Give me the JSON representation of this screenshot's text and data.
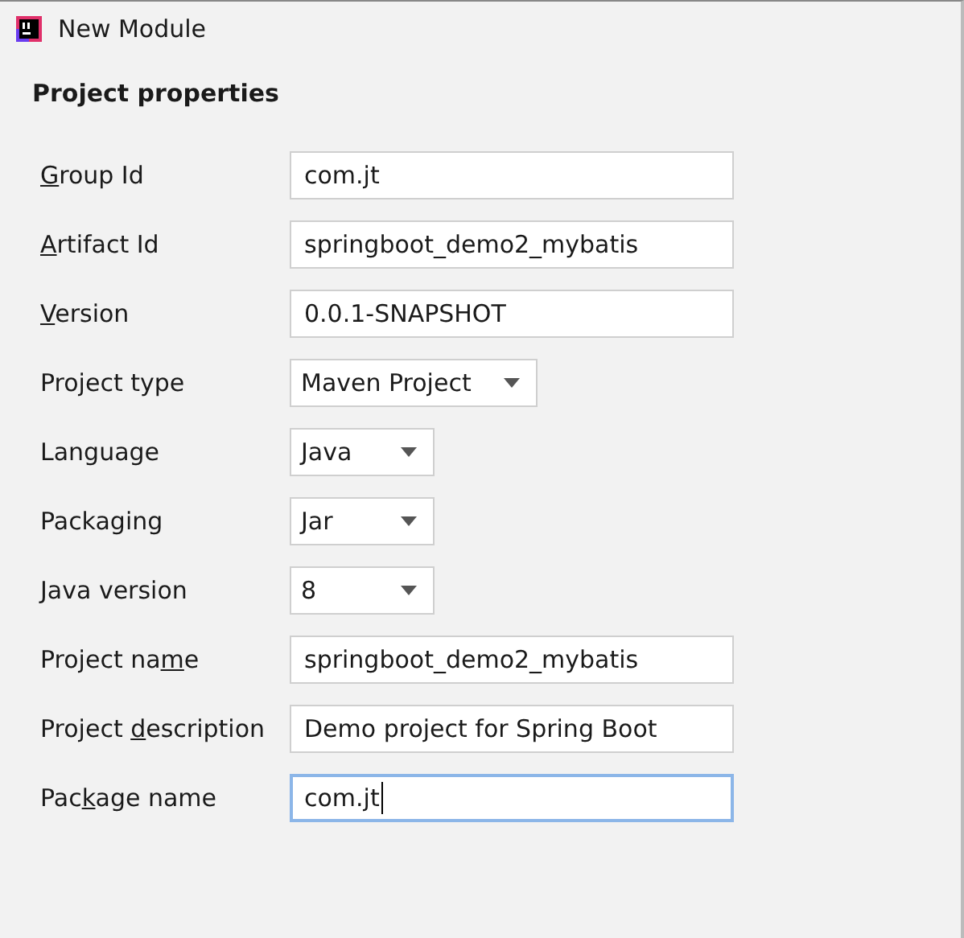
{
  "window": {
    "title": "New Module"
  },
  "section_title": "Project properties",
  "rows": [
    {
      "label": {
        "key": "G",
        "after": "roup Id"
      },
      "kind": "text",
      "value": "com.jt",
      "focused": false
    },
    {
      "label": {
        "key": "A",
        "after": "rtifact Id"
      },
      "kind": "text",
      "value": "springboot_demo2_mybatis",
      "focused": false
    },
    {
      "label": {
        "key": "V",
        "after": "ersion"
      },
      "kind": "text",
      "value": "0.0.1-SNAPSHOT",
      "focused": false
    },
    {
      "label": {
        "before": "Project type"
      },
      "kind": "dropdown",
      "value": "Maven Project"
    },
    {
      "label": {
        "before": "Language"
      },
      "kind": "dropdown",
      "value": "Java"
    },
    {
      "label": {
        "before": "Packaging"
      },
      "kind": "dropdown",
      "value": "Jar"
    },
    {
      "label": {
        "before": "Java version"
      },
      "kind": "dropdown",
      "value": "8"
    },
    {
      "label": {
        "before": "Project na",
        "key": "m",
        "after": "e"
      },
      "kind": "text",
      "value": "springboot_demo2_mybatis",
      "focused": false
    },
    {
      "label": {
        "before": "Project ",
        "key": "d",
        "after": "escription"
      },
      "kind": "text",
      "value": "Demo project for Spring Boot",
      "focused": false
    },
    {
      "label": {
        "before": "Pac",
        "key": "k",
        "after": "age name"
      },
      "kind": "text",
      "value": "com.jt",
      "focused": true
    }
  ]
}
